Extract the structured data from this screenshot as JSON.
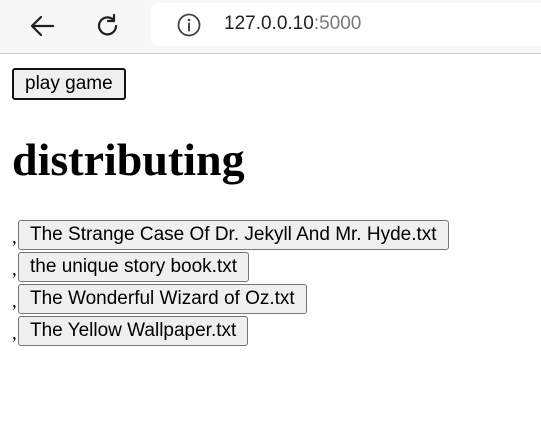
{
  "browser": {
    "back_icon": "back-arrow-icon",
    "reload_icon": "reload-icon",
    "info_icon": "info-icon",
    "url_host": "127.0.0.10",
    "url_port": ":5000"
  },
  "page": {
    "play_button_label": "play game",
    "heading": "distributing",
    "separator": ",",
    "files": [
      {
        "label": "The Strange Case Of Dr. Jekyll And Mr. Hyde.txt"
      },
      {
        "label": "the unique story book.txt"
      },
      {
        "label": "The Wonderful Wizard of Oz.txt"
      },
      {
        "label": "The Yellow Wallpaper.txt"
      }
    ]
  },
  "colors": {
    "toolbar_bg": "#f7f7f7",
    "button_bg": "#efefef",
    "url_port": "#7a7a7a"
  }
}
